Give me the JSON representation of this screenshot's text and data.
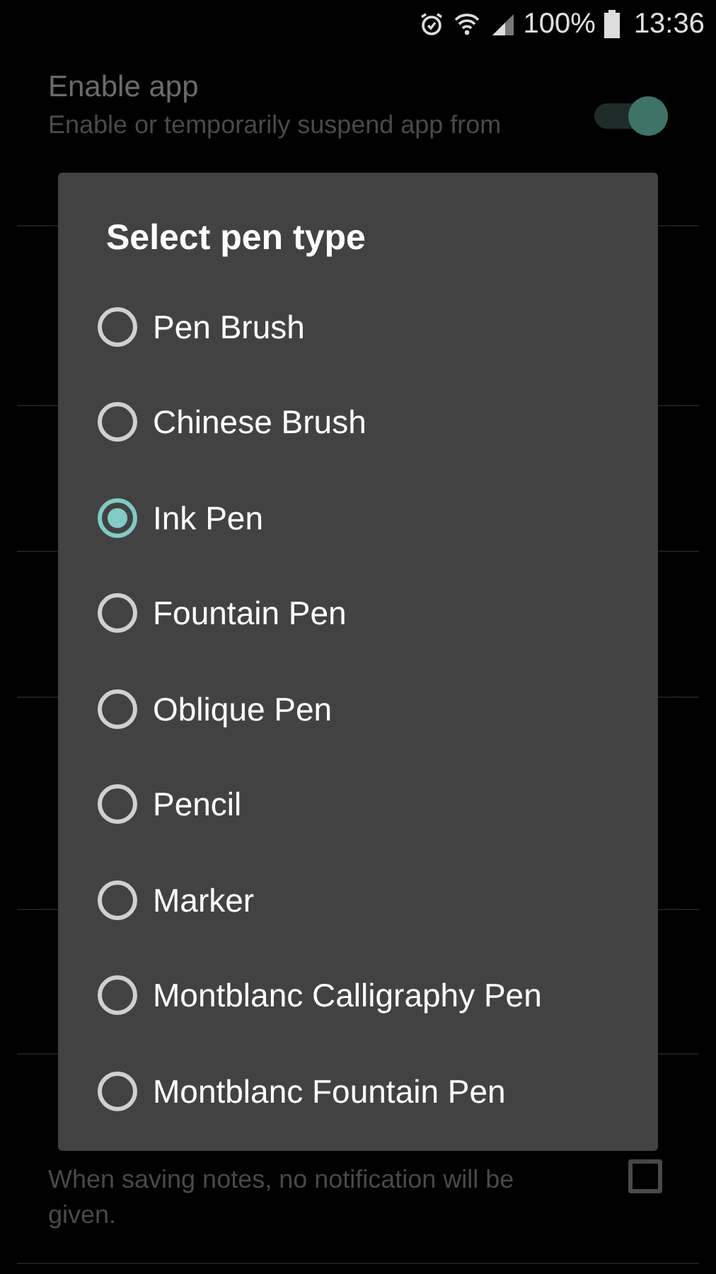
{
  "status_bar": {
    "battery_text": "100%",
    "time": "13:36"
  },
  "settings": [
    {
      "title": "Enable app",
      "summary": [
        "Enable or temporarily suspend app from"
      ],
      "kind": "switch",
      "on": true
    },
    {
      "summary": [
        "When saving notes, no notification will be",
        "given."
      ],
      "kind": "checkbox",
      "checked": false
    }
  ],
  "dialog": {
    "title": "Select pen type",
    "options": [
      {
        "label": "Pen Brush",
        "selected": false
      },
      {
        "label": "Chinese Brush",
        "selected": false
      },
      {
        "label": "Ink Pen",
        "selected": true
      },
      {
        "label": "Fountain Pen",
        "selected": false
      },
      {
        "label": "Oblique Pen",
        "selected": false
      },
      {
        "label": "Pencil",
        "selected": false
      },
      {
        "label": "Marker",
        "selected": false
      },
      {
        "label": "Montblanc Calligraphy Pen",
        "selected": false
      },
      {
        "label": "Montblanc Fountain Pen",
        "selected": false
      }
    ]
  }
}
